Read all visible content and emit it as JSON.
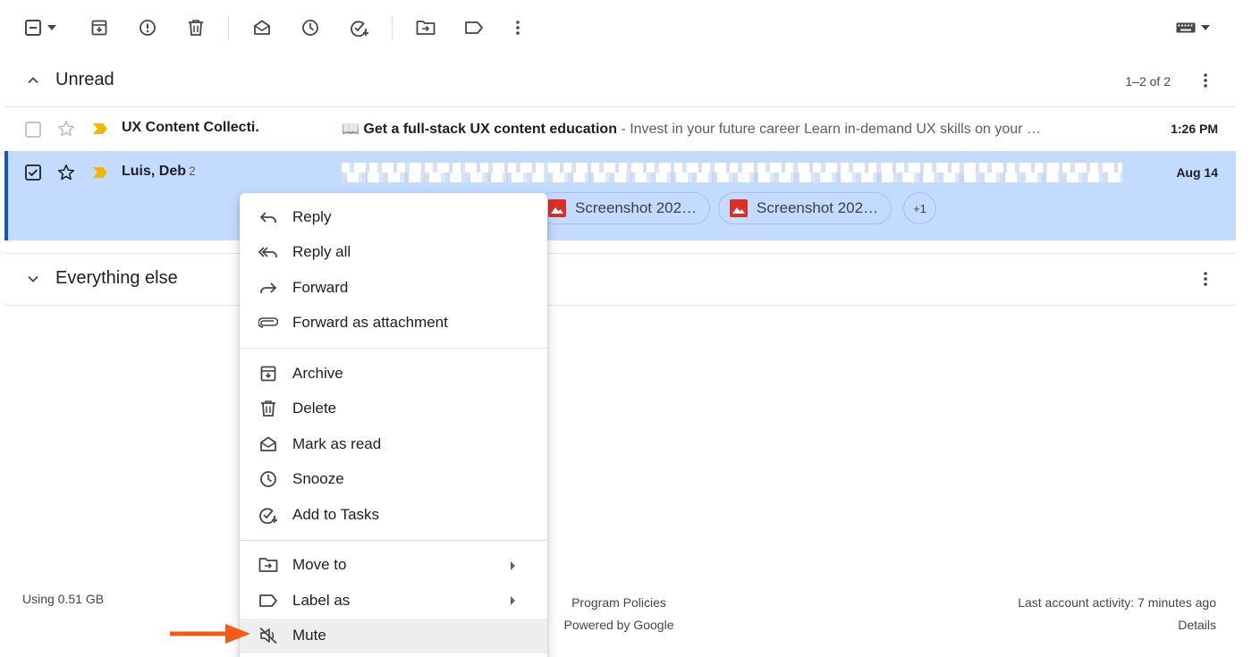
{
  "toolbar": {
    "buttons": [
      "select-all",
      "archive",
      "report-spam",
      "delete",
      "mark-as-read",
      "snooze",
      "add-to-tasks",
      "move-to",
      "label-as",
      "more"
    ]
  },
  "sections": {
    "unread": {
      "title": "Unread",
      "count": "1–2 of 2"
    },
    "everything_else": {
      "title": "Everything else"
    }
  },
  "emails": [
    {
      "sender": "UX Content Collecti.",
      "subject": "📖 Get a full-stack UX content education",
      "snippet": " - Invest in your future career Learn in-demand UX skills on your …",
      "time": "1:26 PM",
      "selected": false
    },
    {
      "sender": "Luis, Deb",
      "thread_count": "2",
      "time": "Aug 14",
      "selected": true,
      "attachments": [
        "Screenshot 202…",
        "Screenshot 202…"
      ],
      "more_attachments": "+1"
    }
  ],
  "context_menu": {
    "items": [
      {
        "label": "Reply",
        "icon": "reply-icon"
      },
      {
        "label": "Reply all",
        "icon": "reply-all-icon"
      },
      {
        "label": "Forward",
        "icon": "forward-icon"
      },
      {
        "label": "Forward as attachment",
        "icon": "paperclip-icon"
      },
      {
        "label": "Archive",
        "icon": "archive-icon"
      },
      {
        "label": "Delete",
        "icon": "trash-icon"
      },
      {
        "label": "Mark as read",
        "icon": "open-envelope-icon"
      },
      {
        "label": "Snooze",
        "icon": "clock-icon"
      },
      {
        "label": "Add to Tasks",
        "icon": "add-task-icon"
      },
      {
        "label": "Move to",
        "icon": "move-folder-icon"
      },
      {
        "label": "Label as",
        "icon": "label-icon"
      },
      {
        "label": "Mute",
        "icon": "mute-icon"
      }
    ]
  },
  "footer": {
    "storage": "Using 0.51 GB",
    "program_policies": "Program Policies",
    "powered_by": "Powered by Google",
    "last_activity": "Last account activity: 7 minutes ago",
    "details": "Details"
  },
  "colors": {
    "selected_row": "#c2dbff",
    "selected_accent": "#0b57d0",
    "important_marker": "#f2b705",
    "annotation_arrow": "#f25c19"
  }
}
